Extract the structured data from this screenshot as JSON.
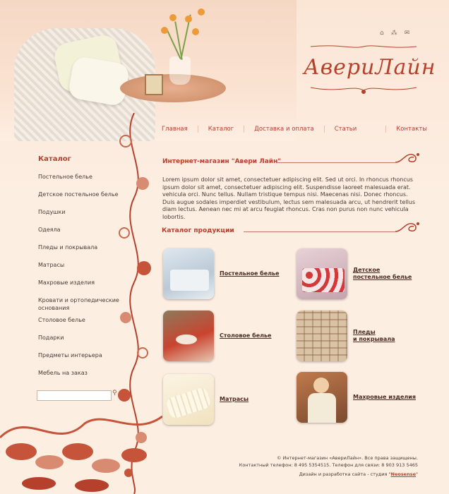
{
  "logo": {
    "text": "АвериЛайн"
  },
  "top_icons": [
    "home-icon",
    "sitemap-icon",
    "mail-icon"
  ],
  "nav": [
    "Главная",
    "Каталог",
    "Доставка и оплата",
    "Статьи",
    "Контакты"
  ],
  "sidebar": {
    "title": "Каталог",
    "items": [
      "Постельное белье",
      "Детское постельное белье",
      "Подушки",
      "Одеяла",
      "Пледы и покрывала",
      "Матрасы",
      "Махровые изделия",
      "Кровати и ортопедические основания",
      "Столовое белье",
      "Подарки",
      "Предметы интерьера",
      "Мебель на заказ"
    ],
    "search_placeholder": ""
  },
  "main": {
    "shop_title": "Интернет-магазин \"Авери Лайн\"",
    "intro": "Lorem ipsum dolor sit amet, consectetuer adipiscing elit. Sed ut orci. In rhoncus rhoncus ipsum dolor sit amet, consectetuer adipiscing elit. Suspendisse laoreet malesuada erat. vehicula orci. Nunc tellus. Nullam tristique tempus nisi. Maecenas nisi. Donec rhoncus. Duis augue sodales imperdiet vestibulum, lectus sem malesuada arcu, ut hendrerit tellus diam lectus. Aenean nec mi at arcu feugiat rhoncus. Cras non purus non nunc vehicula lobortis.",
    "catalog_title": "Каталог продукции",
    "products": [
      {
        "label": "Постельное белье"
      },
      {
        "label": "Детское\nпостельное белье"
      },
      {
        "label": "Столовое белье"
      },
      {
        "label": "Пледы\nи покрывала"
      },
      {
        "label": "Матрасы"
      },
      {
        "label": "Махровые изделия"
      }
    ]
  },
  "footer": {
    "line1": "© Интернет-магазин «АвериЛайн». Все права защищены.",
    "line2": "Контактный телефон: 8 495 5354515. Телефон для связи: 8 903 913 5465",
    "line3": "Дизайн и разработка сайта - студия \"",
    "studio": "Neosense",
    "line3_end": "\""
  },
  "colors": {
    "accent": "#b5412d",
    "background": "#fdeee2"
  }
}
